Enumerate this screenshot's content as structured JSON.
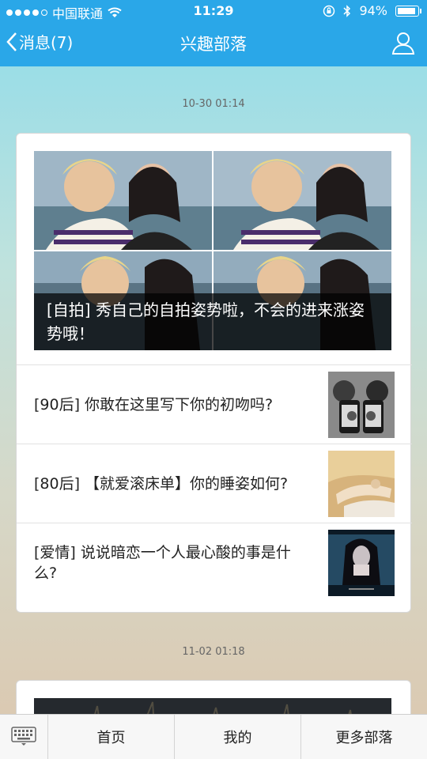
{
  "status": {
    "carrier": "中国联通",
    "time": "11:29",
    "battery": "94%"
  },
  "nav": {
    "back_label": "消息(7)",
    "title": "兴趣部落"
  },
  "feed": [
    {
      "time": "10-30 01:14",
      "hero_caption": "[自拍] 秀自己的自拍姿势啦，不会的进来涨姿势哦！",
      "items": [
        {
          "text": "[90后] 你敢在这里写下你的初吻吗?"
        },
        {
          "text": "[80后] 【就爱滚床单】你的睡姿如何?"
        },
        {
          "text": "[爱情] 说说暗恋一个人最心酸的事是什么?"
        }
      ]
    },
    {
      "time": "11-02 01:18"
    }
  ],
  "tabbar": {
    "items": [
      "首页",
      "我的",
      "更多部落"
    ]
  },
  "colors": {
    "accent": "#2aa7e8"
  }
}
